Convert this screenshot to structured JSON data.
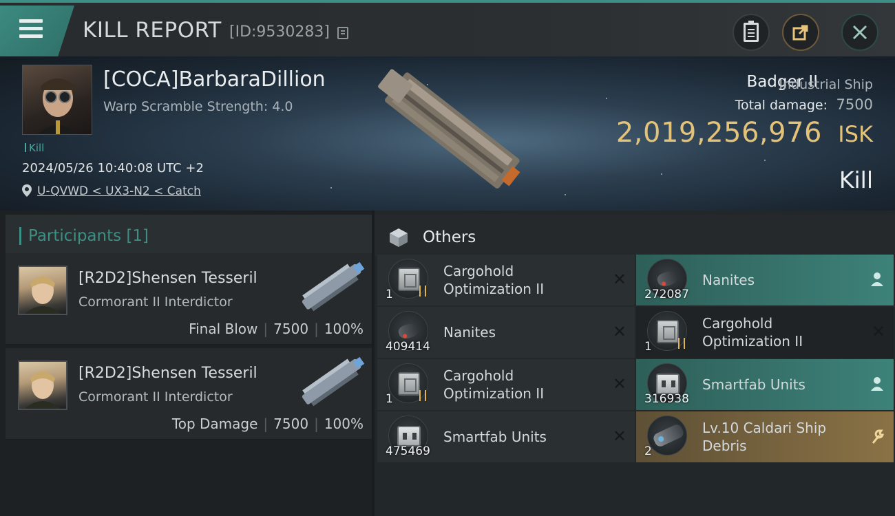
{
  "header": {
    "title": "KILL REPORT",
    "report_id": "[ID:9530283]",
    "accent": "#3d8f86"
  },
  "victim": {
    "name": "[COCA]BarbaraDillion",
    "warp_scramble": "Warp Scramble Strength: 4.0",
    "kill_tag": "Kill",
    "timestamp": "2024/05/26 10:40:08 UTC +2",
    "location": "U-QVWD < UX3-N2 < Catch",
    "ship_name": "Badger II",
    "ship_class": "Industrial Ship",
    "total_damage_label": "Total damage:",
    "total_damage": "7500",
    "isk_value": "2,019,256,976",
    "isk_unit": "ISK",
    "result": "Kill",
    "isk_color": "#e3c27a"
  },
  "participants": {
    "label": "Participants",
    "count": "[1]",
    "items": [
      {
        "name": "[R2D2]Shensen Tesseril",
        "ship": "Cormorant II Interdictor",
        "role": "Final Blow",
        "damage": "7500",
        "percent": "100%"
      },
      {
        "name": "[R2D2]Shensen Tesseril",
        "ship": "Cormorant II Interdictor",
        "role": "Top Damage",
        "damage": "7500",
        "percent": "100%"
      }
    ]
  },
  "others": {
    "label": "Others",
    "items": [
      {
        "name": "Cargohold\nOptimization II",
        "qty": "1",
        "icon": "cargohold-icon",
        "status": "destroyed"
      },
      {
        "name": "Nanites",
        "qty": "272087",
        "icon": "nanites-icon",
        "status": "dropped"
      },
      {
        "name": "Nanites",
        "qty": "409414",
        "icon": "nanites-icon",
        "status": "destroyed"
      },
      {
        "name": "Cargohold\nOptimization II",
        "qty": "1",
        "icon": "cargohold-icon",
        "status": "destroyed"
      },
      {
        "name": "Cargohold\nOptimization II",
        "qty": "1",
        "icon": "cargohold-icon",
        "status": "destroyed"
      },
      {
        "name": "Smartfab Units",
        "qty": "316938",
        "icon": "smartfab-icon",
        "status": "dropped"
      },
      {
        "name": "Smartfab Units",
        "qty": "475469",
        "icon": "smartfab-icon",
        "status": "destroyed"
      },
      {
        "name": "Lv.10 Caldari Ship\nDebris",
        "qty": "2",
        "icon": "debris-icon",
        "status": "salvage"
      }
    ]
  }
}
